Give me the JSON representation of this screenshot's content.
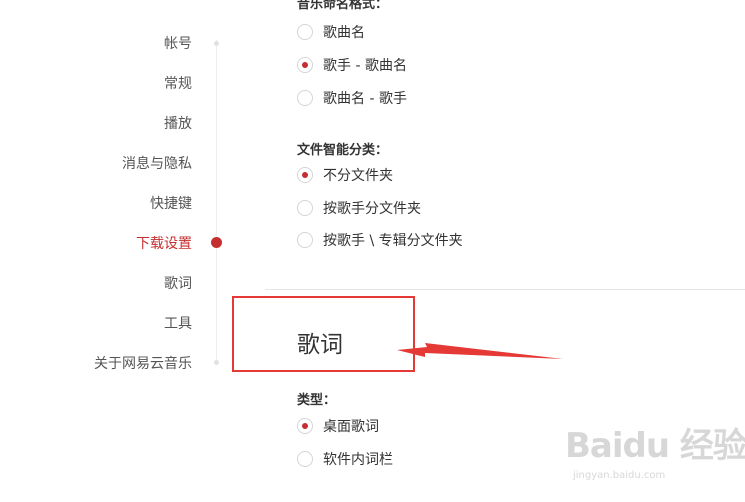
{
  "sidebar": {
    "items": [
      {
        "label": "帐号",
        "active": false
      },
      {
        "label": "常规",
        "active": false
      },
      {
        "label": "播放",
        "active": false
      },
      {
        "label": "消息与隐私",
        "active": false
      },
      {
        "label": "快捷键",
        "active": false
      },
      {
        "label": "下载设置",
        "active": true
      },
      {
        "label": "歌词",
        "active": false
      },
      {
        "label": "工具",
        "active": false
      },
      {
        "label": "关于网易云音乐",
        "active": false
      }
    ]
  },
  "download": {
    "naming_heading": "音乐命名格式：",
    "naming_options": [
      {
        "label": "歌曲名",
        "checked": false
      },
      {
        "label": "歌手 - 歌曲名",
        "checked": true
      },
      {
        "label": "歌曲名 - 歌手",
        "checked": false
      }
    ],
    "folder_heading": "文件智能分类：",
    "folder_options": [
      {
        "label": "不分文件夹",
        "checked": true
      },
      {
        "label": "按歌手分文件夹",
        "checked": false
      },
      {
        "label": "按歌手 \\ 专辑分文件夹",
        "checked": false
      }
    ]
  },
  "lyrics": {
    "section_title": "歌词",
    "type_heading": "类型：",
    "type_options": [
      {
        "label": "桌面歌词",
        "checked": true
      },
      {
        "label": "软件内词栏",
        "checked": false
      }
    ]
  },
  "watermark": {
    "logo": "Baidu 经验",
    "url": "jingyan.baidu.com"
  },
  "colors": {
    "accent": "#c62f2f",
    "annotation": "#e53935"
  }
}
